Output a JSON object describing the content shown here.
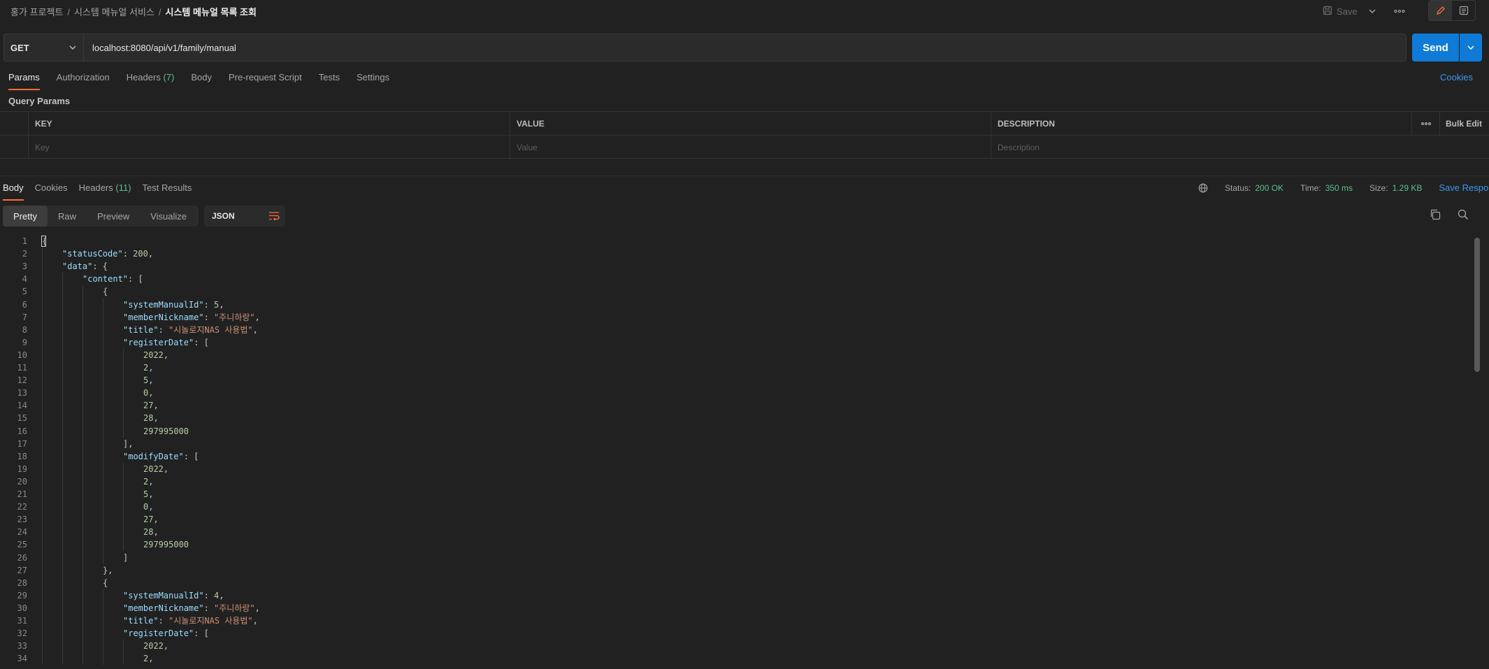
{
  "breadcrumb": {
    "items": [
      "홍가 프로젝트",
      "시스템 메뉴얼 서비스"
    ],
    "current": "시스템 메뉴얼 목록 조회",
    "separator": "/"
  },
  "toolbar": {
    "save_label": "Save"
  },
  "request": {
    "method": "GET",
    "url": "localhost:8080/api/v1/family/manual",
    "send_label": "Send"
  },
  "request_tabs": {
    "params": "Params",
    "authorization": "Authorization",
    "headers": "Headers",
    "headers_count": "(7)",
    "body": "Body",
    "pre_request": "Pre-request Script",
    "tests": "Tests",
    "settings": "Settings",
    "cookies": "Cookies"
  },
  "query_params": {
    "title": "Query Params",
    "columns": {
      "key": "KEY",
      "value": "VALUE",
      "description": "DESCRIPTION"
    },
    "bulk_edit": "Bulk Edit",
    "placeholders": {
      "key": "Key",
      "value": "Value",
      "description": "Description"
    }
  },
  "response_tabs": {
    "body": "Body",
    "cookies": "Cookies",
    "headers": "Headers",
    "headers_count": "(11)",
    "test_results": "Test Results"
  },
  "response_status": {
    "status_label": "Status:",
    "status_value": "200 OK",
    "time_label": "Time:",
    "time_value": "350 ms",
    "size_label": "Size:",
    "size_value": "1.29 KB",
    "save_response": "Save Response"
  },
  "format": {
    "pretty": "Pretty",
    "raw": "Raw",
    "preview": "Preview",
    "visualize": "Visualize",
    "language": "JSON"
  },
  "colors": {
    "accent_orange": "#ff6c37",
    "send_blue": "#0f7bd6",
    "link_blue": "#3b98f0",
    "status_green": "#58c28a"
  },
  "code_lines": [
    {
      "n": "1",
      "indent": 0,
      "parts": [
        [
          "p",
          "{"
        ]
      ]
    },
    {
      "n": "2",
      "indent": 1,
      "parts": [
        [
          "k",
          "\"statusCode\""
        ],
        [
          "p",
          ": "
        ],
        [
          "n",
          "200"
        ],
        [
          "p",
          ","
        ]
      ]
    },
    {
      "n": "3",
      "indent": 1,
      "parts": [
        [
          "k",
          "\"data\""
        ],
        [
          "p",
          ": {"
        ]
      ]
    },
    {
      "n": "4",
      "indent": 2,
      "parts": [
        [
          "k",
          "\"content\""
        ],
        [
          "p",
          ": ["
        ]
      ]
    },
    {
      "n": "5",
      "indent": 3,
      "parts": [
        [
          "p",
          "{"
        ]
      ]
    },
    {
      "n": "6",
      "indent": 4,
      "parts": [
        [
          "k",
          "\"systemManualId\""
        ],
        [
          "p",
          ": "
        ],
        [
          "n",
          "5"
        ],
        [
          "p",
          ","
        ]
      ]
    },
    {
      "n": "7",
      "indent": 4,
      "parts": [
        [
          "k",
          "\"memberNickname\""
        ],
        [
          "p",
          ": "
        ],
        [
          "s",
          "\"주니하랑\""
        ],
        [
          "p",
          ","
        ]
      ]
    },
    {
      "n": "8",
      "indent": 4,
      "parts": [
        [
          "k",
          "\"title\""
        ],
        [
          "p",
          ": "
        ],
        [
          "s",
          "\"시놀로지NAS 사용법\""
        ],
        [
          "p",
          ","
        ]
      ]
    },
    {
      "n": "9",
      "indent": 4,
      "parts": [
        [
          "k",
          "\"registerDate\""
        ],
        [
          "p",
          ": ["
        ]
      ]
    },
    {
      "n": "10",
      "indent": 5,
      "parts": [
        [
          "n",
          "2022"
        ],
        [
          "p",
          ","
        ]
      ]
    },
    {
      "n": "11",
      "indent": 5,
      "parts": [
        [
          "n",
          "2"
        ],
        [
          "p",
          ","
        ]
      ]
    },
    {
      "n": "12",
      "indent": 5,
      "parts": [
        [
          "n",
          "5"
        ],
        [
          "p",
          ","
        ]
      ]
    },
    {
      "n": "13",
      "indent": 5,
      "parts": [
        [
          "n",
          "0"
        ],
        [
          "p",
          ","
        ]
      ]
    },
    {
      "n": "14",
      "indent": 5,
      "parts": [
        [
          "n",
          "27"
        ],
        [
          "p",
          ","
        ]
      ]
    },
    {
      "n": "15",
      "indent": 5,
      "parts": [
        [
          "n",
          "28"
        ],
        [
          "p",
          ","
        ]
      ]
    },
    {
      "n": "16",
      "indent": 5,
      "parts": [
        [
          "n",
          "297995000"
        ]
      ]
    },
    {
      "n": "17",
      "indent": 4,
      "parts": [
        [
          "p",
          "],"
        ]
      ]
    },
    {
      "n": "18",
      "indent": 4,
      "parts": [
        [
          "k",
          "\"modifyDate\""
        ],
        [
          "p",
          ": ["
        ]
      ]
    },
    {
      "n": "19",
      "indent": 5,
      "parts": [
        [
          "n",
          "2022"
        ],
        [
          "p",
          ","
        ]
      ]
    },
    {
      "n": "20",
      "indent": 5,
      "parts": [
        [
          "n",
          "2"
        ],
        [
          "p",
          ","
        ]
      ]
    },
    {
      "n": "21",
      "indent": 5,
      "parts": [
        [
          "n",
          "5"
        ],
        [
          "p",
          ","
        ]
      ]
    },
    {
      "n": "22",
      "indent": 5,
      "parts": [
        [
          "n",
          "0"
        ],
        [
          "p",
          ","
        ]
      ]
    },
    {
      "n": "23",
      "indent": 5,
      "parts": [
        [
          "n",
          "27"
        ],
        [
          "p",
          ","
        ]
      ]
    },
    {
      "n": "24",
      "indent": 5,
      "parts": [
        [
          "n",
          "28"
        ],
        [
          "p",
          ","
        ]
      ]
    },
    {
      "n": "25",
      "indent": 5,
      "parts": [
        [
          "n",
          "297995000"
        ]
      ]
    },
    {
      "n": "26",
      "indent": 4,
      "parts": [
        [
          "p",
          "]"
        ]
      ]
    },
    {
      "n": "27",
      "indent": 3,
      "parts": [
        [
          "p",
          "},"
        ]
      ]
    },
    {
      "n": "28",
      "indent": 3,
      "parts": [
        [
          "p",
          "{"
        ]
      ]
    },
    {
      "n": "29",
      "indent": 4,
      "parts": [
        [
          "k",
          "\"systemManualId\""
        ],
        [
          "p",
          ": "
        ],
        [
          "n",
          "4"
        ],
        [
          "p",
          ","
        ]
      ]
    },
    {
      "n": "30",
      "indent": 4,
      "parts": [
        [
          "k",
          "\"memberNickname\""
        ],
        [
          "p",
          ": "
        ],
        [
          "s",
          "\"주니하랑\""
        ],
        [
          "p",
          ","
        ]
      ]
    },
    {
      "n": "31",
      "indent": 4,
      "parts": [
        [
          "k",
          "\"title\""
        ],
        [
          "p",
          ": "
        ],
        [
          "s",
          "\"시놀로지NAS 사용법\""
        ],
        [
          "p",
          ","
        ]
      ]
    },
    {
      "n": "32",
      "indent": 4,
      "parts": [
        [
          "k",
          "\"registerDate\""
        ],
        [
          "p",
          ": ["
        ]
      ]
    },
    {
      "n": "33",
      "indent": 5,
      "parts": [
        [
          "n",
          "2022"
        ],
        [
          "p",
          ","
        ]
      ]
    },
    {
      "n": "34",
      "indent": 5,
      "parts": [
        [
          "n",
          "2"
        ],
        [
          "p",
          ","
        ]
      ]
    }
  ]
}
